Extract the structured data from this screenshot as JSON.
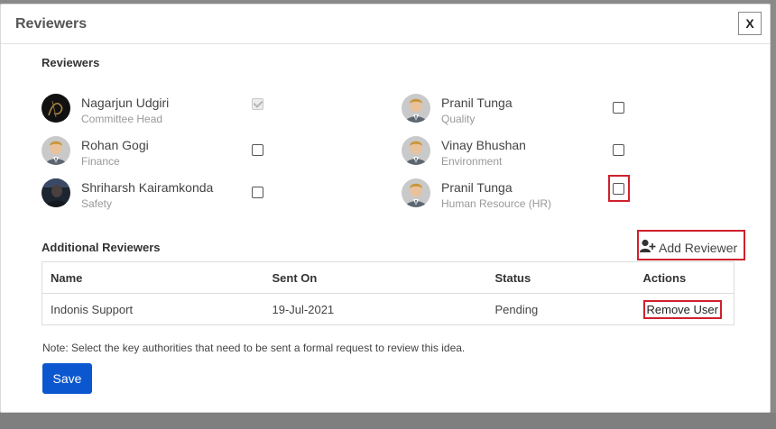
{
  "modal": {
    "title": "Reviewers",
    "close_label": "X"
  },
  "reviewers_section": {
    "title": "Reviewers",
    "items": [
      {
        "name": "Nagarjun Udgiri",
        "role": "Committee Head",
        "checked": true,
        "disabled": true,
        "avatar": "photo-dark"
      },
      {
        "name": "Pranil Tunga",
        "role": "Quality",
        "checked": false,
        "avatar": "default-person"
      },
      {
        "name": "Rohan Gogi",
        "role": "Finance",
        "checked": false,
        "avatar": "default-person"
      },
      {
        "name": "Vinay Bhushan",
        "role": "Environment",
        "checked": false,
        "avatar": "default-person"
      },
      {
        "name": "Shriharsh Kairamkonda",
        "role": "Safety",
        "checked": false,
        "avatar": "photo-person"
      },
      {
        "name": "Pranil Tunga",
        "role": "Human Resource (HR)",
        "checked": false,
        "avatar": "default-person"
      }
    ]
  },
  "additional_section": {
    "title": "Additional Reviewers",
    "add_button_label": "Add Reviewer",
    "add_icon": "user-plus-icon",
    "columns": [
      "Name",
      "Sent On",
      "Status",
      "Actions"
    ],
    "rows": [
      {
        "name": "Indonis Support",
        "sent_on": "19-Jul-2021",
        "status": "Pending",
        "action": "Remove User"
      }
    ]
  },
  "note": "Note: Select the key authorities that need to be sent a formal request to review this idea.",
  "save_label": "Save",
  "colors": {
    "primary": "#0b57d0",
    "highlight": "#d0202d"
  }
}
